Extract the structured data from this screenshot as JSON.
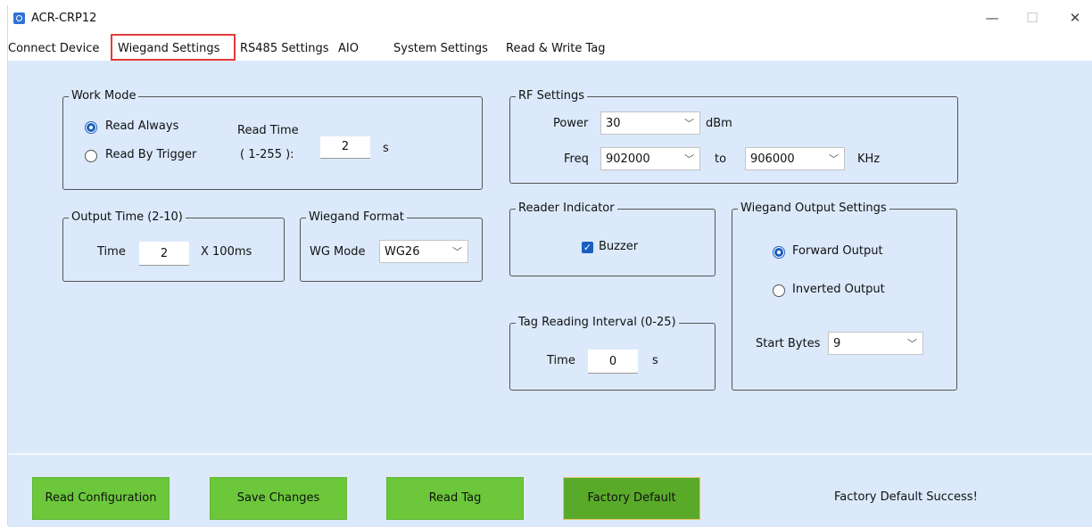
{
  "window": {
    "title": "ACR-CRP12",
    "minimize": "—",
    "maximize": "☐",
    "close": "✕"
  },
  "tabs": [
    {
      "label": "Connect Device"
    },
    {
      "label": "Wiegand Settings"
    },
    {
      "label": "RS485 Settings"
    },
    {
      "label": "AIO"
    },
    {
      "label": "System Settings"
    },
    {
      "label": "Read & Write Tag"
    }
  ],
  "work_mode": {
    "title": "Work Mode",
    "read_always": "Read Always",
    "read_by_trigger": "Read By Trigger",
    "read_time_label": "Read Time",
    "read_time_range": "( 1-255 ):",
    "read_time_value": "2",
    "read_time_unit": "s"
  },
  "rf": {
    "title": "RF Settings",
    "power_label": "Power",
    "power_value": "30",
    "power_unit": "dBm",
    "freq_label": "Freq",
    "freq_from": "902000",
    "freq_to_label": "to",
    "freq_to": "906000",
    "freq_unit": "KHz"
  },
  "output_time": {
    "title": "Output Time (2-10)",
    "time_label": "Time",
    "value": "2",
    "unit": "X 100ms"
  },
  "wiegand_format": {
    "title": "Wiegand Format",
    "mode_label": "WG Mode",
    "mode_value": "WG26"
  },
  "reader_indicator": {
    "title": "Reader Indicator",
    "buzzer": "Buzzer"
  },
  "wiegand_output": {
    "title": "Wiegand Output Settings",
    "forward": "Forward Output",
    "inverted": "Inverted Output",
    "start_bytes_label": "Start Bytes",
    "start_bytes_value": "9"
  },
  "tag_interval": {
    "title": "Tag Reading Interval (0-25)",
    "time_label": "Time",
    "value": "0",
    "unit": "s"
  },
  "buttons": {
    "read_config": "Read Configuration",
    "save_changes": "Save Changes",
    "read_tag": "Read Tag",
    "factory_default": "Factory Default"
  },
  "status": "Factory Default Success!",
  "icons": {
    "dropdown": "chevron-down-icon",
    "check": "check-icon"
  },
  "colors": {
    "panel": "#dbe9fb",
    "button": "#6cc83a",
    "active_tab_border": "#e23b3b",
    "accent": "#1a5fbf"
  }
}
